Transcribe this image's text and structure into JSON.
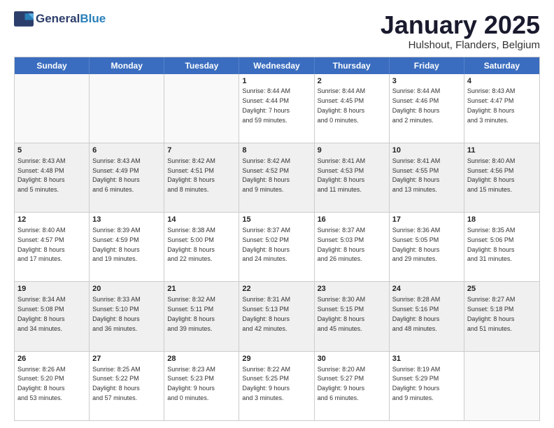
{
  "logo": {
    "general": "General",
    "blue": "Blue"
  },
  "title": "January 2025",
  "subtitle": "Hulshout, Flanders, Belgium",
  "header_days": [
    "Sunday",
    "Monday",
    "Tuesday",
    "Wednesday",
    "Thursday",
    "Friday",
    "Saturday"
  ],
  "weeks": [
    [
      {
        "day": "",
        "info": ""
      },
      {
        "day": "",
        "info": ""
      },
      {
        "day": "",
        "info": ""
      },
      {
        "day": "1",
        "info": "Sunrise: 8:44 AM\nSunset: 4:44 PM\nDaylight: 7 hours\nand 59 minutes."
      },
      {
        "day": "2",
        "info": "Sunrise: 8:44 AM\nSunset: 4:45 PM\nDaylight: 8 hours\nand 0 minutes."
      },
      {
        "day": "3",
        "info": "Sunrise: 8:44 AM\nSunset: 4:46 PM\nDaylight: 8 hours\nand 2 minutes."
      },
      {
        "day": "4",
        "info": "Sunrise: 8:43 AM\nSunset: 4:47 PM\nDaylight: 8 hours\nand 3 minutes."
      }
    ],
    [
      {
        "day": "5",
        "info": "Sunrise: 8:43 AM\nSunset: 4:48 PM\nDaylight: 8 hours\nand 5 minutes."
      },
      {
        "day": "6",
        "info": "Sunrise: 8:43 AM\nSunset: 4:49 PM\nDaylight: 8 hours\nand 6 minutes."
      },
      {
        "day": "7",
        "info": "Sunrise: 8:42 AM\nSunset: 4:51 PM\nDaylight: 8 hours\nand 8 minutes."
      },
      {
        "day": "8",
        "info": "Sunrise: 8:42 AM\nSunset: 4:52 PM\nDaylight: 8 hours\nand 9 minutes."
      },
      {
        "day": "9",
        "info": "Sunrise: 8:41 AM\nSunset: 4:53 PM\nDaylight: 8 hours\nand 11 minutes."
      },
      {
        "day": "10",
        "info": "Sunrise: 8:41 AM\nSunset: 4:55 PM\nDaylight: 8 hours\nand 13 minutes."
      },
      {
        "day": "11",
        "info": "Sunrise: 8:40 AM\nSunset: 4:56 PM\nDaylight: 8 hours\nand 15 minutes."
      }
    ],
    [
      {
        "day": "12",
        "info": "Sunrise: 8:40 AM\nSunset: 4:57 PM\nDaylight: 8 hours\nand 17 minutes."
      },
      {
        "day": "13",
        "info": "Sunrise: 8:39 AM\nSunset: 4:59 PM\nDaylight: 8 hours\nand 19 minutes."
      },
      {
        "day": "14",
        "info": "Sunrise: 8:38 AM\nSunset: 5:00 PM\nDaylight: 8 hours\nand 22 minutes."
      },
      {
        "day": "15",
        "info": "Sunrise: 8:37 AM\nSunset: 5:02 PM\nDaylight: 8 hours\nand 24 minutes."
      },
      {
        "day": "16",
        "info": "Sunrise: 8:37 AM\nSunset: 5:03 PM\nDaylight: 8 hours\nand 26 minutes."
      },
      {
        "day": "17",
        "info": "Sunrise: 8:36 AM\nSunset: 5:05 PM\nDaylight: 8 hours\nand 29 minutes."
      },
      {
        "day": "18",
        "info": "Sunrise: 8:35 AM\nSunset: 5:06 PM\nDaylight: 8 hours\nand 31 minutes."
      }
    ],
    [
      {
        "day": "19",
        "info": "Sunrise: 8:34 AM\nSunset: 5:08 PM\nDaylight: 8 hours\nand 34 minutes."
      },
      {
        "day": "20",
        "info": "Sunrise: 8:33 AM\nSunset: 5:10 PM\nDaylight: 8 hours\nand 36 minutes."
      },
      {
        "day": "21",
        "info": "Sunrise: 8:32 AM\nSunset: 5:11 PM\nDaylight: 8 hours\nand 39 minutes."
      },
      {
        "day": "22",
        "info": "Sunrise: 8:31 AM\nSunset: 5:13 PM\nDaylight: 8 hours\nand 42 minutes."
      },
      {
        "day": "23",
        "info": "Sunrise: 8:30 AM\nSunset: 5:15 PM\nDaylight: 8 hours\nand 45 minutes."
      },
      {
        "day": "24",
        "info": "Sunrise: 8:28 AM\nSunset: 5:16 PM\nDaylight: 8 hours\nand 48 minutes."
      },
      {
        "day": "25",
        "info": "Sunrise: 8:27 AM\nSunset: 5:18 PM\nDaylight: 8 hours\nand 51 minutes."
      }
    ],
    [
      {
        "day": "26",
        "info": "Sunrise: 8:26 AM\nSunset: 5:20 PM\nDaylight: 8 hours\nand 53 minutes."
      },
      {
        "day": "27",
        "info": "Sunrise: 8:25 AM\nSunset: 5:22 PM\nDaylight: 8 hours\nand 57 minutes."
      },
      {
        "day": "28",
        "info": "Sunrise: 8:23 AM\nSunset: 5:23 PM\nDaylight: 9 hours\nand 0 minutes."
      },
      {
        "day": "29",
        "info": "Sunrise: 8:22 AM\nSunset: 5:25 PM\nDaylight: 9 hours\nand 3 minutes."
      },
      {
        "day": "30",
        "info": "Sunrise: 8:20 AM\nSunset: 5:27 PM\nDaylight: 9 hours\nand 6 minutes."
      },
      {
        "day": "31",
        "info": "Sunrise: 8:19 AM\nSunset: 5:29 PM\nDaylight: 9 hours\nand 9 minutes."
      },
      {
        "day": "",
        "info": ""
      }
    ]
  ],
  "shaded_rows": [
    1,
    3
  ],
  "empty_cells_week0": [
    0,
    1,
    2
  ],
  "empty_cells_week4": [
    6
  ]
}
